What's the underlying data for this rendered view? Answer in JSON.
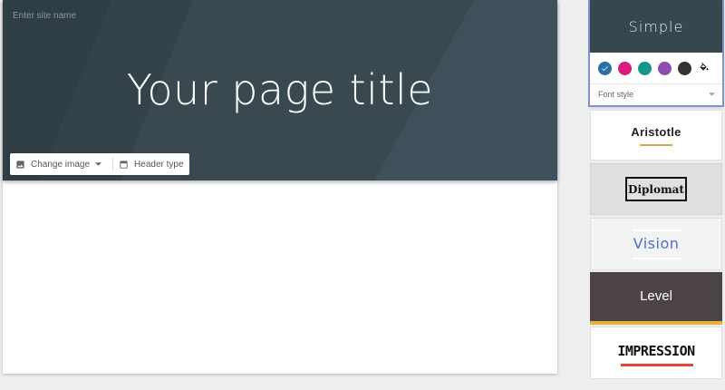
{
  "header": {
    "site_name_placeholder": "Enter site name",
    "page_title": "Your page title",
    "background_color": "#37474f"
  },
  "header_toolbar": {
    "change_image_label": "Change image",
    "change_image_icon": "image-icon",
    "header_type_label": "Header type",
    "header_type_icon": "header-layout-icon"
  },
  "themes": {
    "simple": {
      "name": "Simple",
      "swatches": [
        {
          "color": "#2a6fa8",
          "selected": true
        },
        {
          "color": "#d81b7c",
          "selected": false
        },
        {
          "color": "#14968a",
          "selected": false
        },
        {
          "color": "#8e4bb0",
          "selected": false
        },
        {
          "color": "#333333",
          "selected": false
        }
      ],
      "custom_color_icon": "fill-color-icon",
      "font_style_label": "Font style"
    },
    "aristotle": {
      "name": "Aristotle",
      "accent": "#d7a754"
    },
    "diplomat": {
      "name": "Diplomat"
    },
    "vision": {
      "name": "Vision",
      "accent": "#4a72c9"
    },
    "level": {
      "name": "Level",
      "accent": "#e8b23a"
    },
    "impression": {
      "name": "IMPRESSION",
      "accent": "#e0463a"
    }
  }
}
